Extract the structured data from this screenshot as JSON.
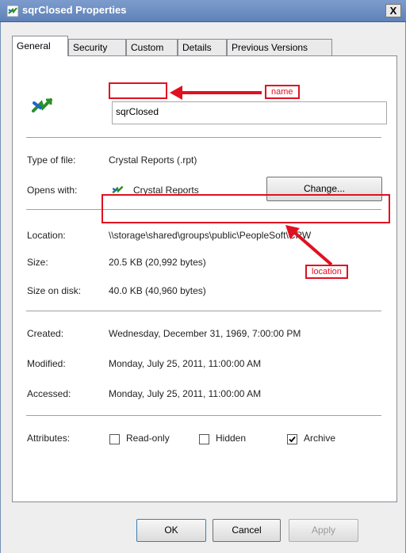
{
  "window": {
    "title": "sqrClosed Properties",
    "close_label": "X"
  },
  "tabs": [
    {
      "label": "General",
      "active": true
    },
    {
      "label": "Security"
    },
    {
      "label": "Custom"
    },
    {
      "label": "Details"
    },
    {
      "label": "Previous Versions"
    }
  ],
  "file": {
    "name": "sqrClosed"
  },
  "annotations": {
    "name_label": "name",
    "location_label": "location",
    "color": "#e01020"
  },
  "fields": {
    "type_label": "Type of file:",
    "type_value": "Crystal Reports (.rpt)",
    "opens_label": "Opens with:",
    "opens_value": "Crystal Reports",
    "change_button": "Change...",
    "location_label": "Location:",
    "location_value": "\\\\storage\\shared\\groups\\public\\PeopleSoft\\CRW",
    "size_label": "Size:",
    "size_value": "20.5 KB (20,992 bytes)",
    "size_disk_label": "Size on disk:",
    "size_disk_value": "40.0 KB (40,960 bytes)",
    "created_label": "Created:",
    "created_value": "Wednesday, December 31, 1969, 7:00:00 PM",
    "modified_label": "Modified:",
    "modified_value": "Monday, July 25, 2011, 11:00:00 AM",
    "accessed_label": "Accessed:",
    "accessed_value": "Monday, July 25, 2011, 11:00:00 AM",
    "attributes_label": "Attributes:"
  },
  "attributes": {
    "readonly": {
      "label": "Read-only",
      "checked": false
    },
    "hidden": {
      "label": "Hidden",
      "checked": false
    },
    "archive": {
      "label": "Archive",
      "checked": true
    }
  },
  "buttons": {
    "ok": "OK",
    "cancel": "Cancel",
    "apply": "Apply"
  }
}
